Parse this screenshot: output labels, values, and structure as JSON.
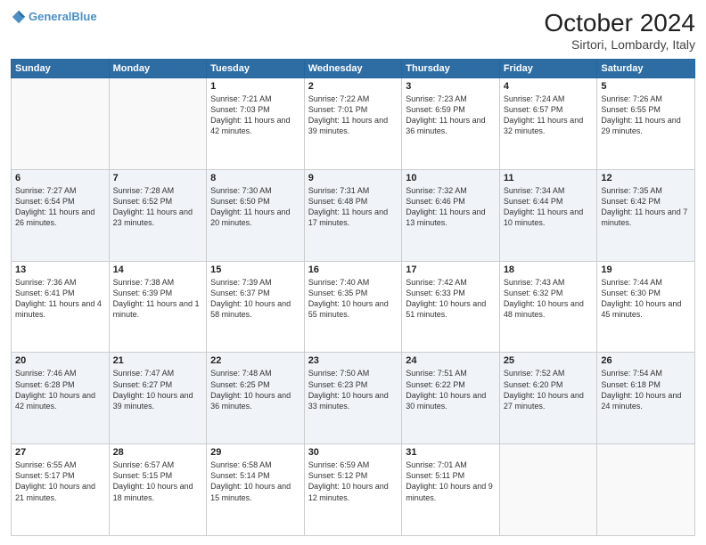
{
  "header": {
    "logo_line1": "General",
    "logo_line2": "Blue",
    "month": "October 2024",
    "location": "Sirtori, Lombardy, Italy"
  },
  "weekdays": [
    "Sunday",
    "Monday",
    "Tuesday",
    "Wednesday",
    "Thursday",
    "Friday",
    "Saturday"
  ],
  "weeks": [
    [
      {
        "day": "",
        "info": ""
      },
      {
        "day": "",
        "info": ""
      },
      {
        "day": "1",
        "info": "Sunrise: 7:21 AM\nSunset: 7:03 PM\nDaylight: 11 hours and 42 minutes."
      },
      {
        "day": "2",
        "info": "Sunrise: 7:22 AM\nSunset: 7:01 PM\nDaylight: 11 hours and 39 minutes."
      },
      {
        "day": "3",
        "info": "Sunrise: 7:23 AM\nSunset: 6:59 PM\nDaylight: 11 hours and 36 minutes."
      },
      {
        "day": "4",
        "info": "Sunrise: 7:24 AM\nSunset: 6:57 PM\nDaylight: 11 hours and 32 minutes."
      },
      {
        "day": "5",
        "info": "Sunrise: 7:26 AM\nSunset: 6:55 PM\nDaylight: 11 hours and 29 minutes."
      }
    ],
    [
      {
        "day": "6",
        "info": "Sunrise: 7:27 AM\nSunset: 6:54 PM\nDaylight: 11 hours and 26 minutes."
      },
      {
        "day": "7",
        "info": "Sunrise: 7:28 AM\nSunset: 6:52 PM\nDaylight: 11 hours and 23 minutes."
      },
      {
        "day": "8",
        "info": "Sunrise: 7:30 AM\nSunset: 6:50 PM\nDaylight: 11 hours and 20 minutes."
      },
      {
        "day": "9",
        "info": "Sunrise: 7:31 AM\nSunset: 6:48 PM\nDaylight: 11 hours and 17 minutes."
      },
      {
        "day": "10",
        "info": "Sunrise: 7:32 AM\nSunset: 6:46 PM\nDaylight: 11 hours and 13 minutes."
      },
      {
        "day": "11",
        "info": "Sunrise: 7:34 AM\nSunset: 6:44 PM\nDaylight: 11 hours and 10 minutes."
      },
      {
        "day": "12",
        "info": "Sunrise: 7:35 AM\nSunset: 6:42 PM\nDaylight: 11 hours and 7 minutes."
      }
    ],
    [
      {
        "day": "13",
        "info": "Sunrise: 7:36 AM\nSunset: 6:41 PM\nDaylight: 11 hours and 4 minutes."
      },
      {
        "day": "14",
        "info": "Sunrise: 7:38 AM\nSunset: 6:39 PM\nDaylight: 11 hours and 1 minute."
      },
      {
        "day": "15",
        "info": "Sunrise: 7:39 AM\nSunset: 6:37 PM\nDaylight: 10 hours and 58 minutes."
      },
      {
        "day": "16",
        "info": "Sunrise: 7:40 AM\nSunset: 6:35 PM\nDaylight: 10 hours and 55 minutes."
      },
      {
        "day": "17",
        "info": "Sunrise: 7:42 AM\nSunset: 6:33 PM\nDaylight: 10 hours and 51 minutes."
      },
      {
        "day": "18",
        "info": "Sunrise: 7:43 AM\nSunset: 6:32 PM\nDaylight: 10 hours and 48 minutes."
      },
      {
        "day": "19",
        "info": "Sunrise: 7:44 AM\nSunset: 6:30 PM\nDaylight: 10 hours and 45 minutes."
      }
    ],
    [
      {
        "day": "20",
        "info": "Sunrise: 7:46 AM\nSunset: 6:28 PM\nDaylight: 10 hours and 42 minutes."
      },
      {
        "day": "21",
        "info": "Sunrise: 7:47 AM\nSunset: 6:27 PM\nDaylight: 10 hours and 39 minutes."
      },
      {
        "day": "22",
        "info": "Sunrise: 7:48 AM\nSunset: 6:25 PM\nDaylight: 10 hours and 36 minutes."
      },
      {
        "day": "23",
        "info": "Sunrise: 7:50 AM\nSunset: 6:23 PM\nDaylight: 10 hours and 33 minutes."
      },
      {
        "day": "24",
        "info": "Sunrise: 7:51 AM\nSunset: 6:22 PM\nDaylight: 10 hours and 30 minutes."
      },
      {
        "day": "25",
        "info": "Sunrise: 7:52 AM\nSunset: 6:20 PM\nDaylight: 10 hours and 27 minutes."
      },
      {
        "day": "26",
        "info": "Sunrise: 7:54 AM\nSunset: 6:18 PM\nDaylight: 10 hours and 24 minutes."
      }
    ],
    [
      {
        "day": "27",
        "info": "Sunrise: 6:55 AM\nSunset: 5:17 PM\nDaylight: 10 hours and 21 minutes."
      },
      {
        "day": "28",
        "info": "Sunrise: 6:57 AM\nSunset: 5:15 PM\nDaylight: 10 hours and 18 minutes."
      },
      {
        "day": "29",
        "info": "Sunrise: 6:58 AM\nSunset: 5:14 PM\nDaylight: 10 hours and 15 minutes."
      },
      {
        "day": "30",
        "info": "Sunrise: 6:59 AM\nSunset: 5:12 PM\nDaylight: 10 hours and 12 minutes."
      },
      {
        "day": "31",
        "info": "Sunrise: 7:01 AM\nSunset: 5:11 PM\nDaylight: 10 hours and 9 minutes."
      },
      {
        "day": "",
        "info": ""
      },
      {
        "day": "",
        "info": ""
      }
    ]
  ]
}
